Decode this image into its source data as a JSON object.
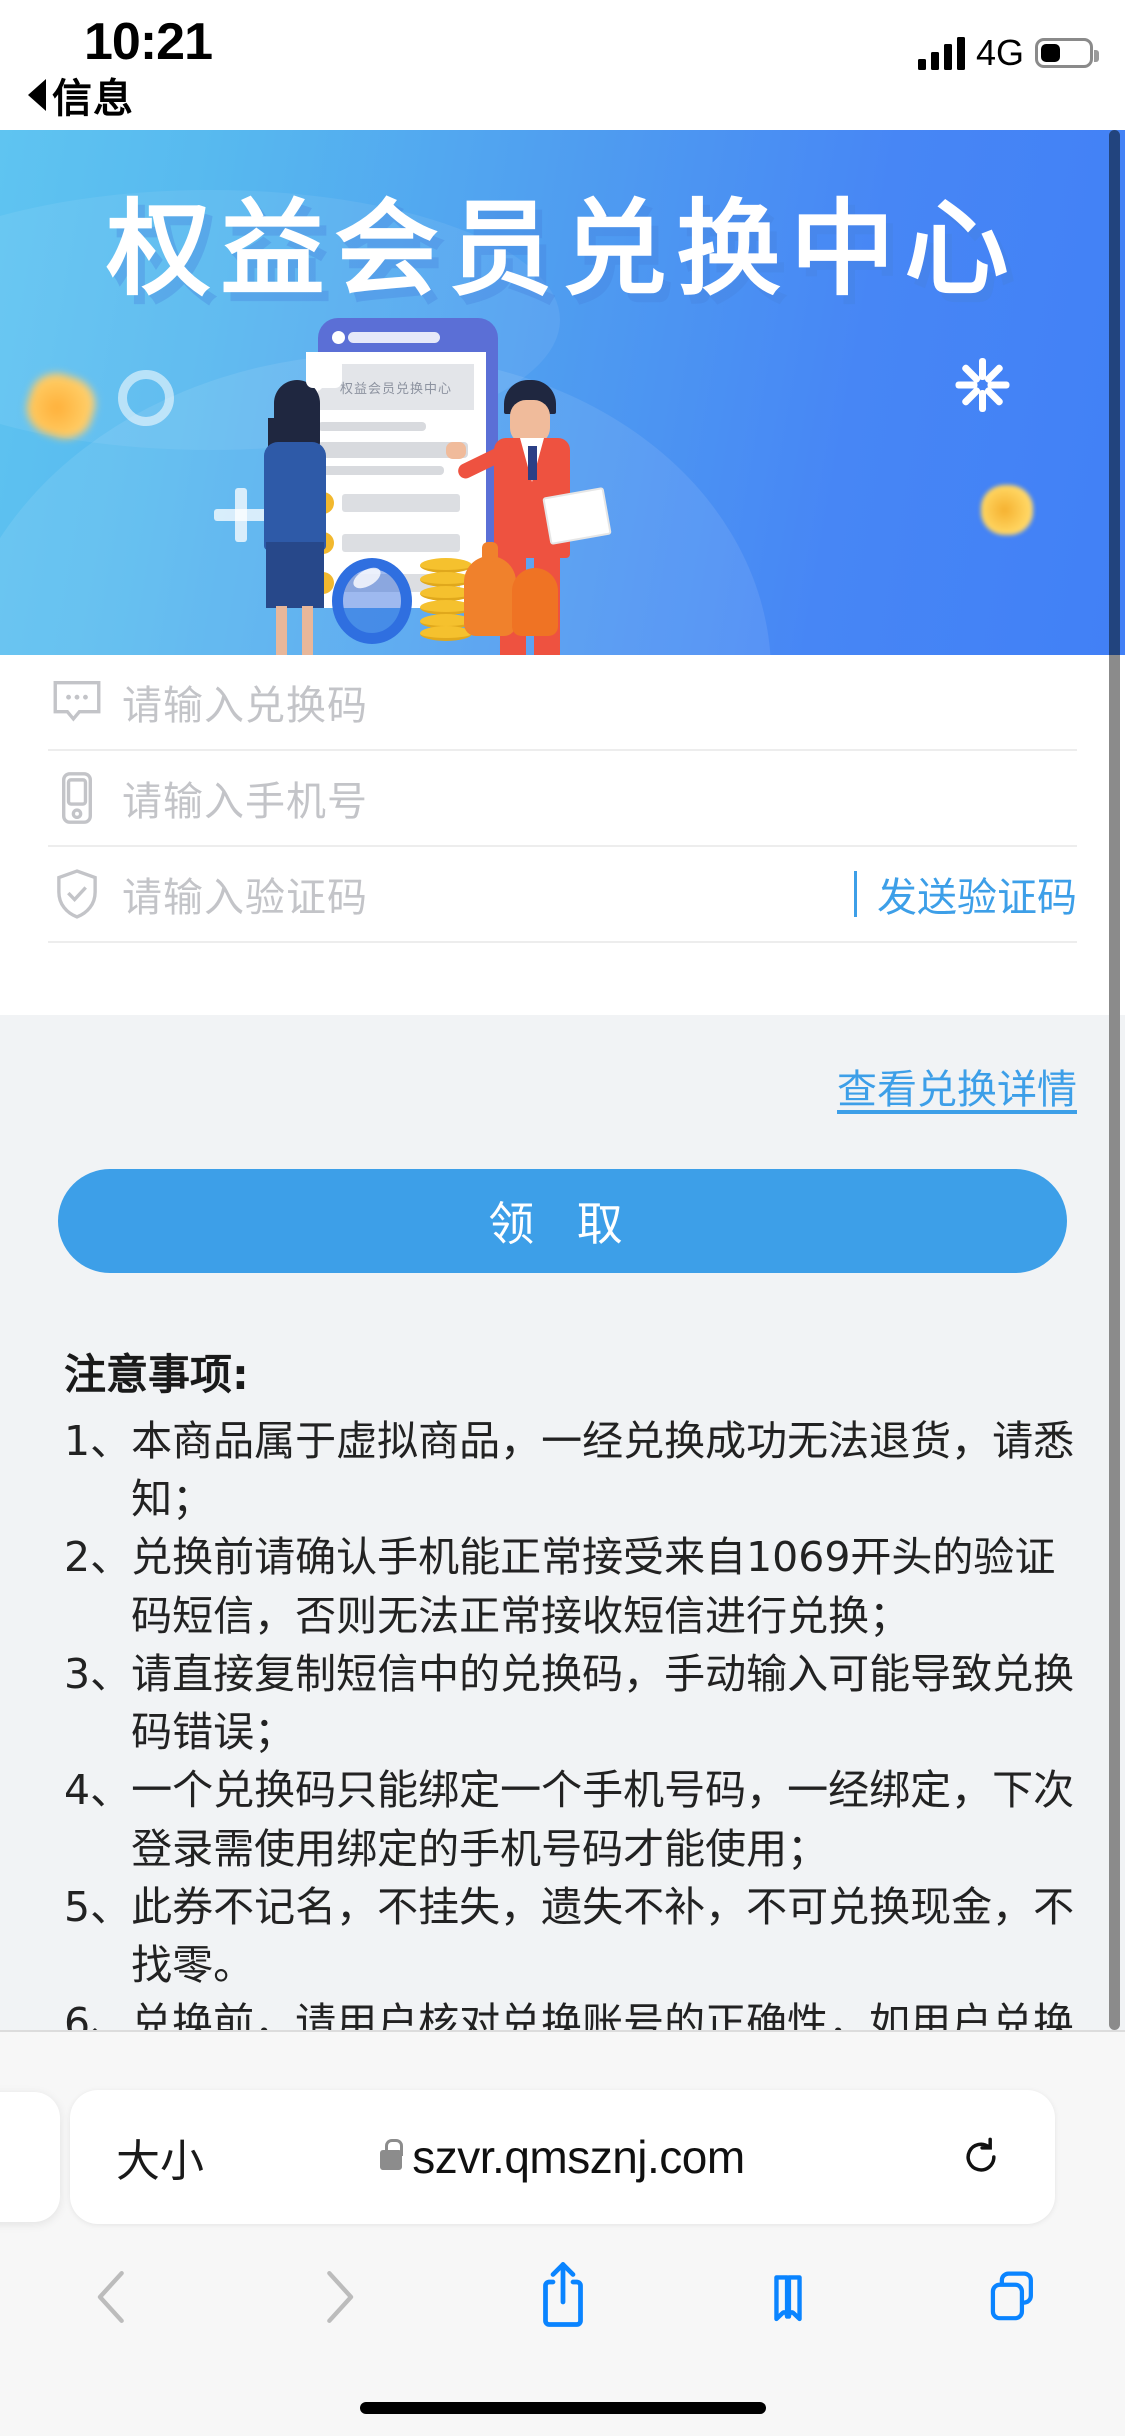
{
  "status_bar": {
    "time": "10:21",
    "back_label": "信息",
    "network": "4G",
    "signal_icon": "signal-bars-icon",
    "battery_icon": "battery-icon"
  },
  "banner": {
    "title": "权益会员兑换中心",
    "phone_mock_label": "权益会员兑换中心",
    "colors": {
      "left": "#5fc4f1",
      "right": "#4180f6"
    }
  },
  "form": {
    "fields": [
      {
        "icon": "chat-bubble-icon",
        "placeholder": "请输入兑换码",
        "value": ""
      },
      {
        "icon": "mobile-phone-icon",
        "placeholder": "请输入手机号",
        "value": ""
      },
      {
        "icon": "shield-check-icon",
        "placeholder": "请输入验证码",
        "value": ""
      }
    ],
    "send_code_label": "发送验证码"
  },
  "actions": {
    "detail_link": "查看兑换详情",
    "claim_button": "领 取",
    "accent_color": "#3d9fe8"
  },
  "notice": {
    "title": "注意事项:",
    "items": [
      {
        "num": "1、",
        "text": "本商品属于虚拟商品，一经兑换成功无法退货，请悉知；"
      },
      {
        "num": "2、",
        "text": "兑换前请确认手机能正常接受来自1069开头的验证码短信，否则无法正常接收短信进行兑换；"
      },
      {
        "num": "3、",
        "text": "请直接复制短信中的兑换码，手动输入可能导致兑换码错误；"
      },
      {
        "num": "4、",
        "text": "一个兑换码只能绑定一个手机号码，一经绑定，下次登录需使用绑定的手机号码才能使用；"
      },
      {
        "num": "5、",
        "text": "此券不记名，不挂失，遗失不补，不可兑换现金，不找零。"
      },
      {
        "num": "6、",
        "text": "兑换前，请用户核对兑换账号的正确性，如用户兑换账号"
      }
    ]
  },
  "browser": {
    "size_button": "大小",
    "url": "szvr.qmsznj.com",
    "lock_icon": "lock-icon",
    "reload_icon": "reload-icon",
    "toolbar": [
      {
        "name": "back-button",
        "icon": "chevron-left-icon",
        "enabled": false
      },
      {
        "name": "forward-button",
        "icon": "chevron-right-icon",
        "enabled": false
      },
      {
        "name": "share-button",
        "icon": "share-icon",
        "enabled": true
      },
      {
        "name": "bookmarks-button",
        "icon": "book-icon",
        "enabled": true
      },
      {
        "name": "tabs-button",
        "icon": "tabs-icon",
        "enabled": true
      }
    ]
  }
}
